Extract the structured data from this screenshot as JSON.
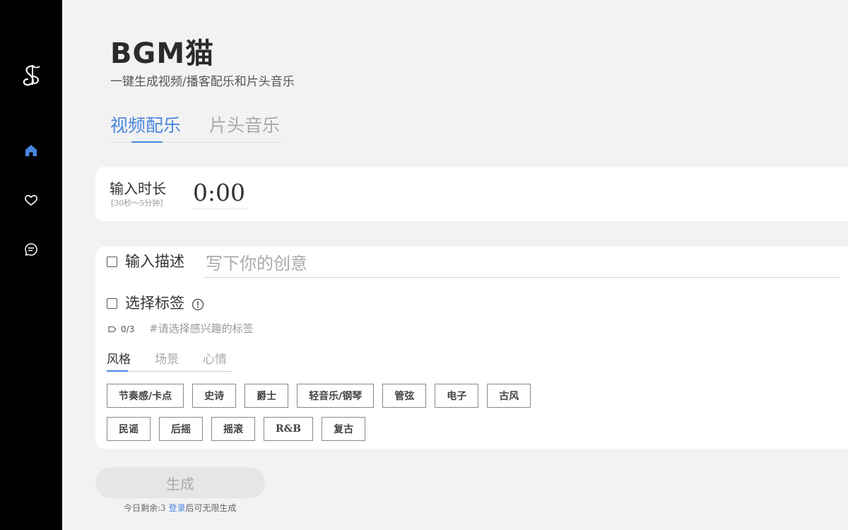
{
  "brand": {
    "title": "BGM猫",
    "subtitle": "一键生成视频/播客配乐和片头音乐"
  },
  "sidebar": {
    "items": [
      {
        "name": "home",
        "icon": "home-icon",
        "active": true
      },
      {
        "name": "favorites",
        "icon": "heart-icon",
        "active": false
      },
      {
        "name": "messages",
        "icon": "chat-icon",
        "active": false
      }
    ]
  },
  "tabs": [
    {
      "label": "视频配乐",
      "active": true
    },
    {
      "label": "片头音乐",
      "active": false
    }
  ],
  "duration": {
    "label": "输入时长",
    "hint": "[30秒～5分钟]",
    "value": "0:00"
  },
  "description": {
    "label": "输入描述",
    "placeholder": "写下你的创意",
    "checked": false
  },
  "tags": {
    "label": "选择标签",
    "checked": false,
    "count": "0/3",
    "hint": "#请选择感兴趣的标签",
    "subtabs": [
      {
        "label": "风格",
        "active": true
      },
      {
        "label": "场景",
        "active": false
      },
      {
        "label": "心情",
        "active": false
      }
    ],
    "chips_row1": [
      "节奏感/卡点",
      "史诗",
      "爵士",
      "轻音乐/钢琴",
      "管弦",
      "电子",
      "古风"
    ],
    "chips_row2": [
      "民谣",
      "后摇",
      "摇滚",
      "R&B",
      "复古"
    ]
  },
  "generate": {
    "label": "生成",
    "quota_prefix": "今日剩余:3 ",
    "login_label": "登录",
    "quota_suffix": "后可无限生成"
  },
  "colors": {
    "accent": "#4a86e0",
    "sidebar_bg": "#000000",
    "page_bg": "#f2f2f2"
  }
}
